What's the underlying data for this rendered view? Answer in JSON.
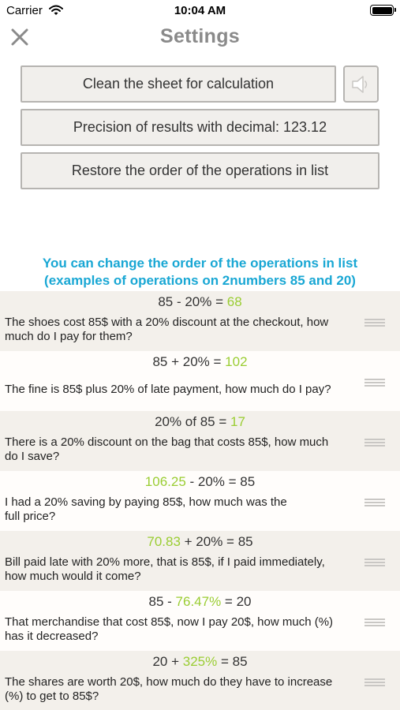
{
  "status_bar": {
    "carrier": "Carrier",
    "time": "10:04 AM"
  },
  "nav": {
    "title": "Settings"
  },
  "buttons": {
    "clean": "Clean the sheet for calculation",
    "precision": "Precision of results with decimal: 123.12",
    "restore": "Restore the order of the operations in list"
  },
  "info": {
    "line1": "You can change the order of the operations in list",
    "line2": "(examples of operations on 2numbers 85 and 20)"
  },
  "colors": {
    "accent_blue": "#19a7d4",
    "result_green": "#9acd32"
  },
  "operations": [
    {
      "f1": "85 - 20% = ",
      "f2": "68",
      "f3": "",
      "desc1": "The shoes cost 85$ with a 20% discount at the checkout, how",
      "desc2": "much do I pay for them?"
    },
    {
      "f1": "85 + 20% = ",
      "f2": "102",
      "f3": "",
      "desc1": "The fine is 85$ plus 20% of late payment, how much do I pay?",
      "desc2": ""
    },
    {
      "f1": "20% of 85 = ",
      "f2": "17",
      "f3": "",
      "desc1": "There is a 20% discount on the bag that costs 85$, how much",
      "desc2": "do I save?"
    },
    {
      "f1": "",
      "f2": "106.25",
      "f3": " - 20% = 85",
      "desc1": "I had a 20% saving by paying 85$, how much was the",
      "desc2": "full price?"
    },
    {
      "f1": "",
      "f2": "70.83",
      "f3": " + 20% = 85",
      "desc1": "Bill paid late with 20% more, that is 85$, if I paid immediately,",
      "desc2": "how much would it come?"
    },
    {
      "f1": "85 - ",
      "f2": "76.47%",
      "f3": " = 20",
      "desc1": "That merchandise that cost 85$, now I pay 20$, how much (%)",
      "desc2": "has it decreased?"
    },
    {
      "f1": "20 + ",
      "f2": "325%",
      "f3": " = 85",
      "desc1": "The shares are worth 20$, how much do they have to increase",
      "desc2": "(%) to get to 85$?"
    }
  ]
}
